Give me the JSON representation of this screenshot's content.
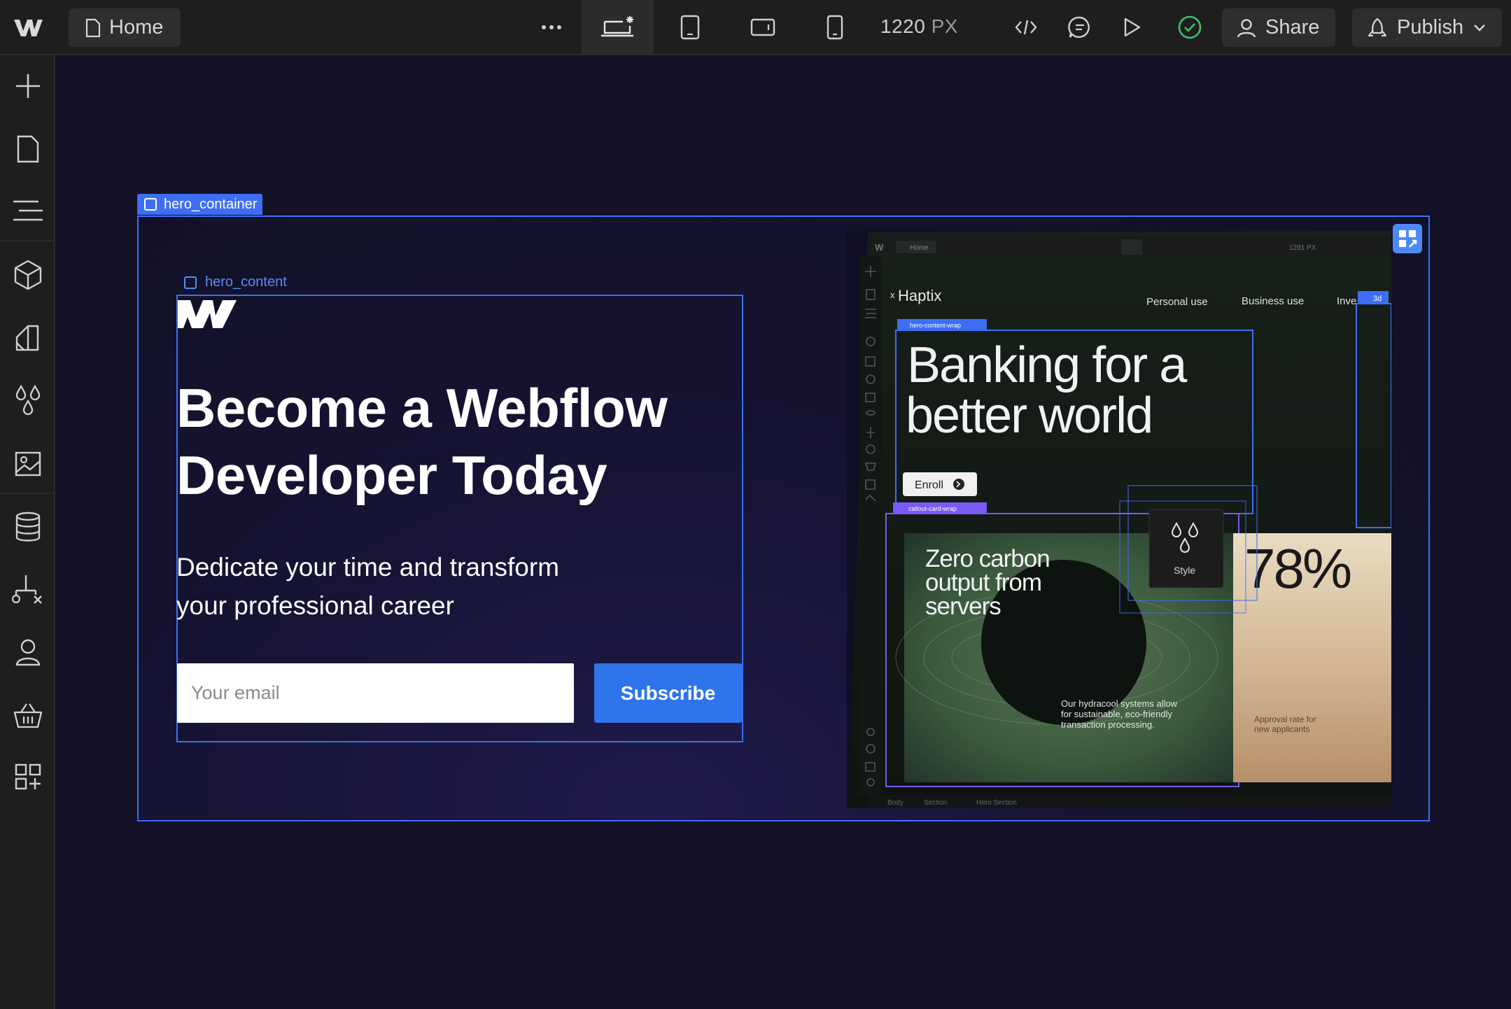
{
  "topbar": {
    "home_label": "Home",
    "more_label": "···",
    "width_value": "1220",
    "width_unit": "PX",
    "share_label": "Share",
    "publish_label": "Publish"
  },
  "canvas": {
    "container_tag": "hero_container",
    "content_tag": "hero_content",
    "headline_line1": "Become a Webflow",
    "headline_line2": "Developer Today",
    "subhead_line1": "Dedicate your time and transform",
    "subhead_line2": "your professional career",
    "email_placeholder": "Your email",
    "subscribe_label": "Subscribe"
  },
  "preview": {
    "home_label": "Home",
    "width_label": "1291 PX",
    "brand": "Haptix",
    "brand_prefix": "x",
    "nav": [
      "Personal use",
      "Business use",
      "Inve"
    ],
    "wrap_tag": "hero-content-wrap",
    "card_tag": "callout-card-wrap",
    "corner_tag": "3d",
    "headline_line1": "Banking for a",
    "headline_line2": "better world",
    "enroll_label": "Enroll",
    "card_title_1": "Zero carbon",
    "card_title_2": "output from",
    "card_title_3": "servers",
    "card_body_1": "Our hydracool systems allow",
    "card_body_2": "for sustainable, eco-friendly",
    "card_body_3": "transaction processing.",
    "stat_value": "78%",
    "stat_caption_1": "Approval rate for",
    "stat_caption_2": "new applicants",
    "style_label": "Style",
    "footer_crumbs": [
      "Body",
      "Section",
      "Hero Section"
    ]
  },
  "colors": {
    "accent_blue": "#3d6ef5",
    "subscribe_blue": "#2f74ea",
    "canvas_bg": "#121127",
    "chrome_bg": "#1e1e1e",
    "status_green": "#3fbf6a"
  }
}
